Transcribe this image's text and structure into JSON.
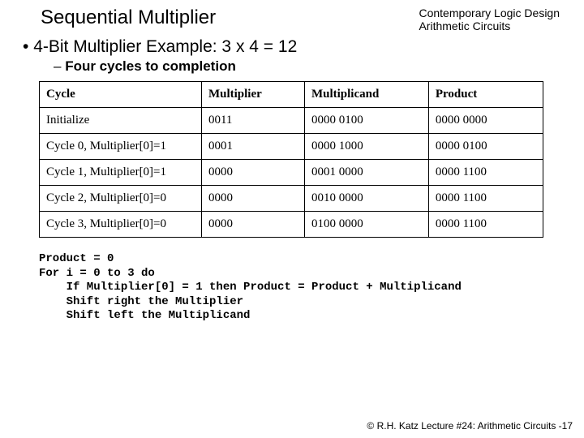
{
  "header": {
    "title": "Sequential Multiplier",
    "corner_line1": "Contemporary Logic Design",
    "corner_line2": "Arithmetic Circuits"
  },
  "bullets": {
    "level1": "4-Bit Multiplier Example: 3 x 4 = 12",
    "level2": "Four cycles to completion"
  },
  "table": {
    "headers": [
      "Cycle",
      "Multiplier",
      "Multiplicand",
      "Product"
    ],
    "rows": [
      [
        "Initialize",
        "0011",
        "0000 0100",
        "0000 0000"
      ],
      [
        "Cycle 0, Multiplier[0]=1",
        "0001",
        "0000 1000",
        "0000 0100"
      ],
      [
        "Cycle 1, Multiplier[0]=1",
        "0000",
        "0001 0000",
        "0000 1100"
      ],
      [
        "Cycle 2, Multiplier[0]=0",
        "0000",
        "0010 0000",
        "0000 1100"
      ],
      [
        "Cycle 3, Multiplier[0]=0",
        "0000",
        "0100 0000",
        "0000 1100"
      ]
    ]
  },
  "algorithm": "Product = 0\nFor i = 0 to 3 do\n    If Multiplier[0] = 1 then Product = Product + Multiplicand\n    Shift right the Multiplier\n    Shift left the Multiplicand",
  "footer": "© R.H. Katz   Lecture #24: Arithmetic Circuits -17"
}
